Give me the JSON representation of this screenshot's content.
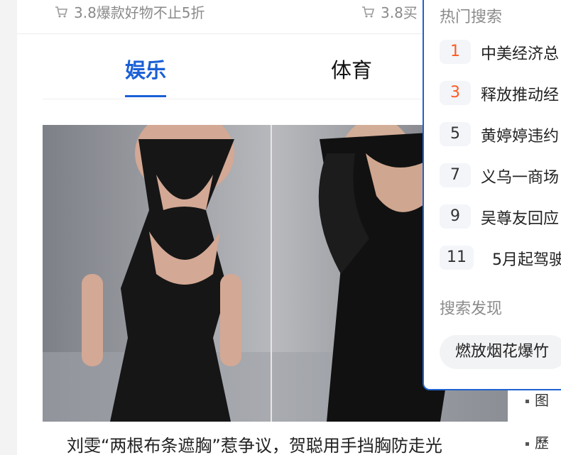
{
  "promos": [
    {
      "text": "3.8爆款好物不止5折"
    },
    {
      "text": "3.8买"
    }
  ],
  "tabs": [
    {
      "label": "娱乐",
      "active": true
    },
    {
      "label": "体育",
      "active": false
    }
  ],
  "news": {
    "caption": "刘雯“两根布条遮胸”惹争议，贺聪用手挡胸防走光"
  },
  "bullets": [
    {
      "text": "图"
    },
    {
      "text": "歷"
    }
  ],
  "hot_search": {
    "title": "热门搜索",
    "items": [
      {
        "rank": "1",
        "text": "中美经济总",
        "rank_color": "#ff5a1f"
      },
      {
        "rank": "3",
        "text": "释放推动经",
        "rank_color": "#ff5a1f"
      },
      {
        "rank": "5",
        "text": "黄婷婷违约",
        "rank_color": "#333333"
      },
      {
        "rank": "7",
        "text": "义乌一商场",
        "rank_color": "#333333"
      },
      {
        "rank": "9",
        "text": "吴尊友回应",
        "rank_color": "#333333"
      },
      {
        "rank": "11",
        "text": "5月起驾驶",
        "rank_color": "#333333"
      }
    ],
    "discover_title": "搜索发现",
    "discover_chip": "燃放烟花爆竹"
  },
  "colors": {
    "accent": "#1a5fd6",
    "hot_rank": "#ff5a1f",
    "panel_border": "#1f62d0"
  }
}
